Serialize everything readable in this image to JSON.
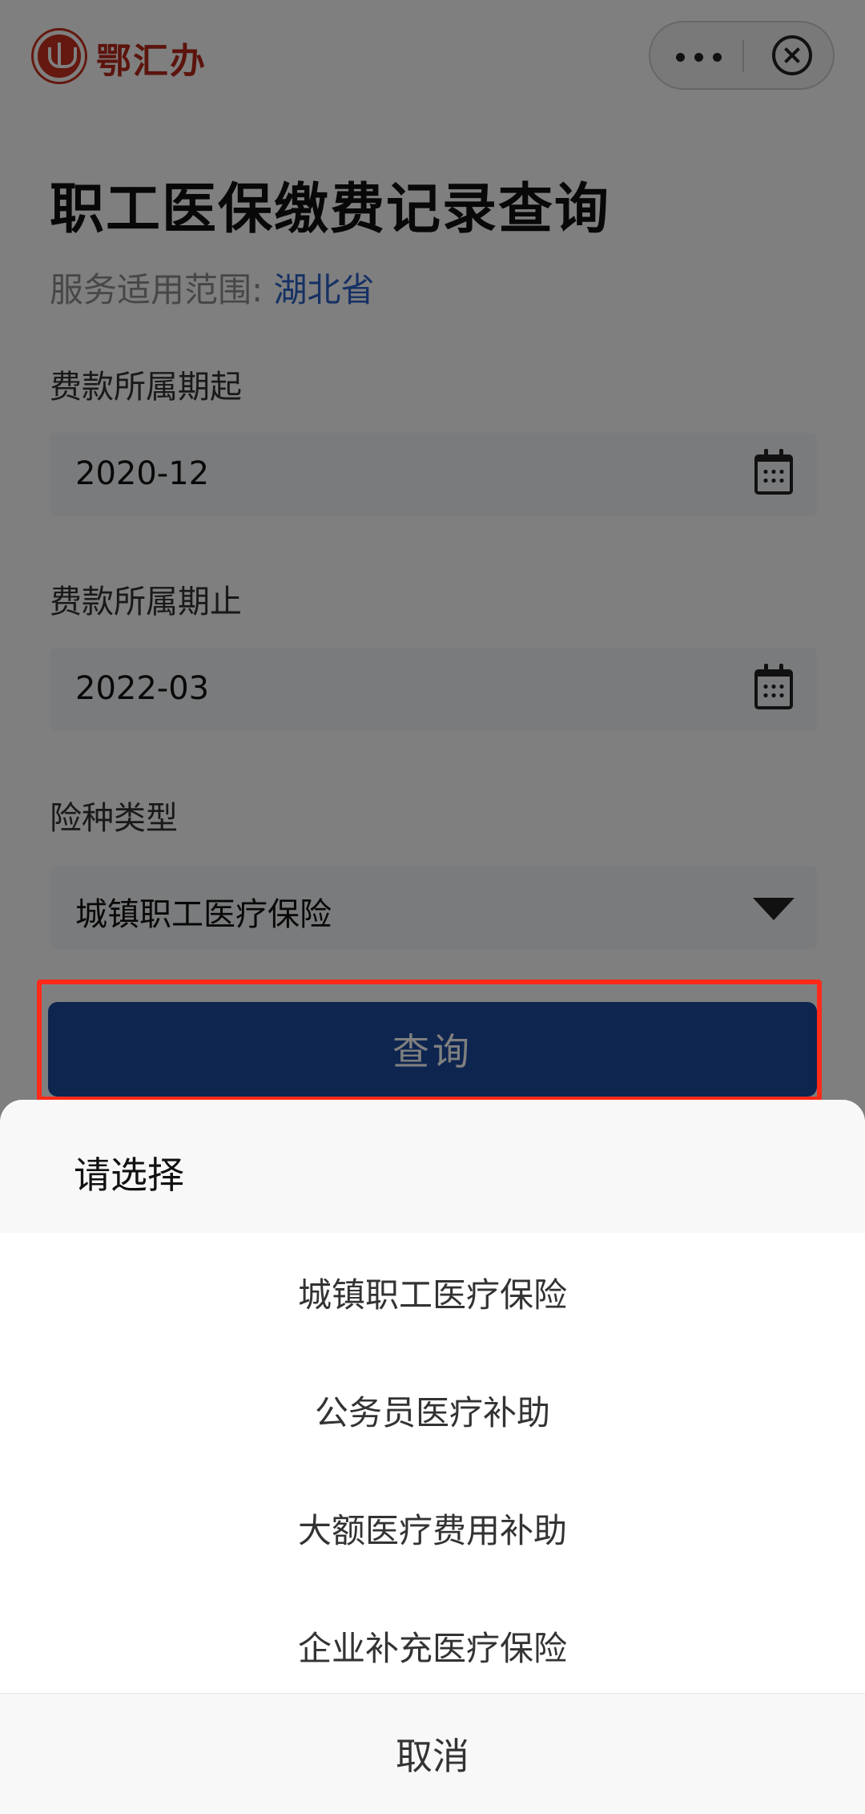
{
  "header": {
    "app_name": "鄂汇办",
    "menu_icon": "more-dots-icon",
    "close_icon": "circle-close-icon"
  },
  "form": {
    "title": "职工医保缴费记录查询",
    "scope_label": "服务适用范围:",
    "scope_value": "湖北省",
    "start": {
      "label": "费款所属期起",
      "value": "2020-12",
      "icon": "calendar-icon"
    },
    "end": {
      "label": "费款所属期止",
      "value": "2022-03",
      "icon": "calendar-icon"
    },
    "type": {
      "label": "险种类型",
      "value": "城镇职工医疗保险",
      "icon": "dropdown-triangle-icon"
    },
    "query_button_label": "查询"
  },
  "action_sheet": {
    "title": "请选择",
    "options": [
      "城镇职工医疗保险",
      "公务员医疗补助",
      "大额医疗费用补助",
      "企业补充医疗保险"
    ],
    "cancel_label": "取消"
  },
  "colors": {
    "brand_red": "#b8281a",
    "button_blue": "#1c4aa0",
    "scope_blue": "#2d63c8",
    "highlight_red": "#ff2a1a"
  }
}
